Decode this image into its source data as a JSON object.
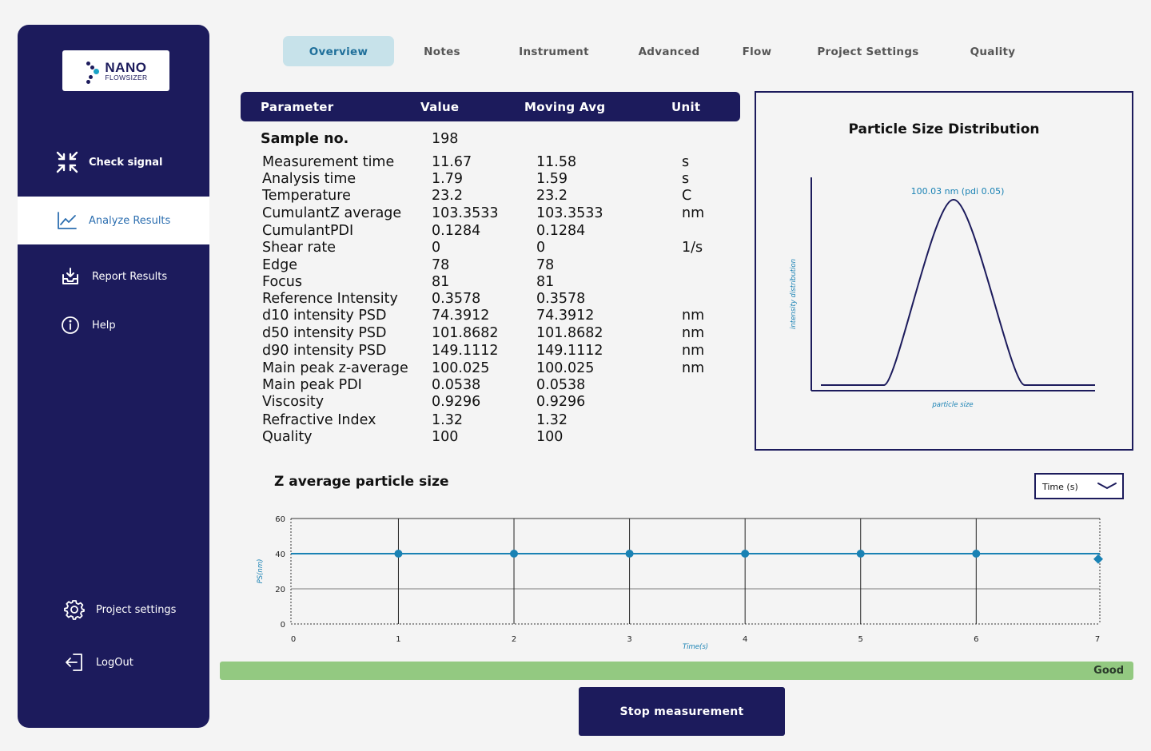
{
  "app": {
    "logo": {
      "brand": "NANO",
      "sub": "FLOWSIZER"
    }
  },
  "sidebar": {
    "items": [
      {
        "label": "Check signal",
        "icon": "compress-arrows-icon",
        "active": false
      },
      {
        "label": "Analyze Results",
        "icon": "line-chart-icon",
        "active": true
      },
      {
        "label": "Report Results",
        "icon": "inbox-download-icon",
        "active": false
      },
      {
        "label": "Help",
        "icon": "info-circle-icon",
        "active": false
      }
    ],
    "bottom": [
      {
        "label": "Project settings",
        "icon": "gear-icon"
      },
      {
        "label": "LogOut",
        "icon": "logout-icon"
      }
    ]
  },
  "tabs": [
    {
      "label": "Overview",
      "active": true
    },
    {
      "label": "Notes"
    },
    {
      "label": "Instrument"
    },
    {
      "label": "Advanced"
    },
    {
      "label": "Flow"
    },
    {
      "label": "Project Settings"
    },
    {
      "label": "Quality"
    }
  ],
  "table": {
    "headers": [
      "Parameter",
      "Value",
      "Moving Avg",
      "Unit"
    ],
    "sample": {
      "label": "Sample no.",
      "value": "198"
    },
    "rows": [
      {
        "param": "Measurement time",
        "value": "11.67",
        "avg": "11.58",
        "unit": "s"
      },
      {
        "param": "Analysis time",
        "value": "1.79",
        "avg": "1.59",
        "unit": "s"
      },
      {
        "param": "Temperature",
        "value": "23.2",
        "avg": "23.2",
        "unit": "C"
      },
      {
        "param": "CumulantZ average",
        "value": "103.3533",
        "avg": "103.3533",
        "unit": "nm"
      },
      {
        "param": "CumulantPDI",
        "value": "0.1284",
        "avg": "0.1284",
        "unit": ""
      },
      {
        "param": "Shear rate",
        "value": "0",
        "avg": "0",
        "unit": "1/s"
      },
      {
        "param": "Edge",
        "value": "78",
        "avg": "78",
        "unit": ""
      },
      {
        "param": "Focus",
        "value": "81",
        "avg": "81",
        "unit": ""
      },
      {
        "param": "Reference Intensity",
        "value": "0.3578",
        "avg": "0.3578",
        "unit": ""
      },
      {
        "param": "d10 intensity PSD",
        "value": "74.3912",
        "avg": "74.3912",
        "unit": "nm"
      },
      {
        "param": "d50 intensity PSD",
        "value": "101.8682",
        "avg": "101.8682",
        "unit": "nm"
      },
      {
        "param": "d90 intensity PSD",
        "value": "149.1112",
        "avg": "149.1112",
        "unit": "nm"
      },
      {
        "param": "Main peak z-average",
        "value": "100.025",
        "avg": "100.025",
        "unit": "nm"
      },
      {
        "param": "Main peak PDI",
        "value": "0.0538",
        "avg": "0.0538",
        "unit": ""
      },
      {
        "param": "Viscosity",
        "value": "0.9296",
        "avg": "0.9296",
        "unit": ""
      },
      {
        "param": "Refractive Index",
        "value": "1.32",
        "avg": "1.32",
        "unit": ""
      },
      {
        "param": "Quality",
        "value": "100",
        "avg": "100",
        "unit": ""
      }
    ]
  },
  "psd": {
    "title": "Particle Size Distribution",
    "peak_label": "100.03 nm  (pdi 0.05)",
    "ylabel": "intensity distribution",
    "xlabel": "particle size"
  },
  "zchart": {
    "title": "Z average particle size",
    "dropdown_value": "Time (s)"
  },
  "chart_data": {
    "type": "line",
    "title": "Z average particle size",
    "xlabel": "Time(s)",
    "ylabel": "PS(nm)",
    "xlim": [
      0,
      7
    ],
    "ylim": [
      0,
      60
    ],
    "xticks": [
      "0",
      "1",
      "2",
      "3",
      "4",
      "5",
      "6",
      "7"
    ],
    "yticks": [
      "0",
      "20",
      "40",
      "60"
    ],
    "series": [
      {
        "x": [
          0.93,
          1.93,
          2.93,
          3.93,
          4.93,
          5.93,
          7.0
        ],
        "y": [
          40,
          40,
          40,
          40,
          40,
          40,
          36
        ],
        "color": "#1a82b4"
      }
    ]
  },
  "status": {
    "label": "Good",
    "color": "#93c981",
    "progress": 1.0
  },
  "actions": {
    "stop_label": "Stop measurement"
  },
  "colors": {
    "primary": "#1c1b5c",
    "accent": "#1a82b4",
    "tab_active": "#c7e2ea"
  }
}
